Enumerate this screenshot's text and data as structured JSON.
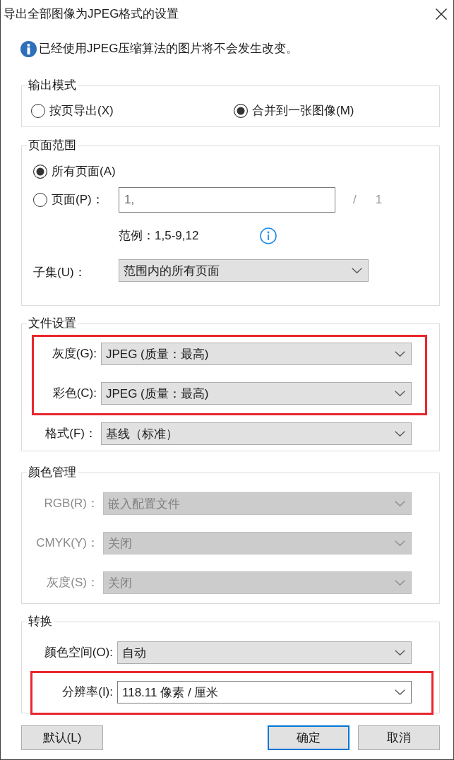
{
  "window": {
    "title": "导出全部图像为JPEG格式的设置"
  },
  "info": {
    "message": "已经使用JPEG压缩算法的图片将不会发生改变。"
  },
  "output_mode": {
    "title": "输出模式",
    "options": [
      {
        "label": "按页导出(X)",
        "selected": false
      },
      {
        "label": "合并到一张图像(M)",
        "selected": true
      }
    ]
  },
  "page_range": {
    "title": "页面范围",
    "options": [
      {
        "kind": "plain",
        "label": "所有页面(A)",
        "selected": true
      },
      {
        "kind": "with-field",
        "label": "页面(P)：",
        "selected": false,
        "field": {
          "value": "1,",
          "disabled": true
        },
        "separator": "/",
        "page_count": "1"
      }
    ],
    "example": "范例：1,5-9,12",
    "subset": {
      "label": "子集(U)：",
      "value": "范围内的所有页面"
    }
  },
  "file_settings": {
    "title": "文件设置",
    "rows": [
      {
        "kind": "dropdown",
        "label": "灰度(G):",
        "value": "JPEG (质量：最高)",
        "disabled": false,
        "highlighted": true
      },
      {
        "kind": "dropdown",
        "label": "彩色(C):",
        "value": "JPEG (质量：最高)",
        "disabled": false,
        "highlighted": true
      },
      {
        "kind": "dropdown",
        "label": "格式(F)：",
        "value": "基线（标准）",
        "disabled": false,
        "highlighted": false
      }
    ]
  },
  "color_management": {
    "title": "颜色管理",
    "rows": [
      {
        "kind": "dropdown",
        "label": "RGB(R)：",
        "value": "嵌入配置文件",
        "disabled": true,
        "highlighted": false
      },
      {
        "kind": "dropdown",
        "label": "CMYK(Y)：",
        "value": "关闭",
        "disabled": true,
        "highlighted": false
      },
      {
        "kind": "dropdown",
        "label": "灰度(S)：",
        "value": "关闭",
        "disabled": true,
        "highlighted": false
      }
    ]
  },
  "conversion": {
    "title": "转换",
    "rows": [
      {
        "kind": "dropdown",
        "label": "颜色空间(O):",
        "value": "自动",
        "disabled": false,
        "highlighted": false
      },
      {
        "kind": "combo",
        "label": "分辨率(I):",
        "value": "118.11 像素 / 厘米",
        "disabled": false,
        "highlighted": true
      }
    ]
  },
  "buttons": [
    {
      "label": "默认(L)",
      "focused": false
    },
    {
      "label": "确定",
      "focused": true
    },
    {
      "label": "取消",
      "focused": false
    }
  ]
}
